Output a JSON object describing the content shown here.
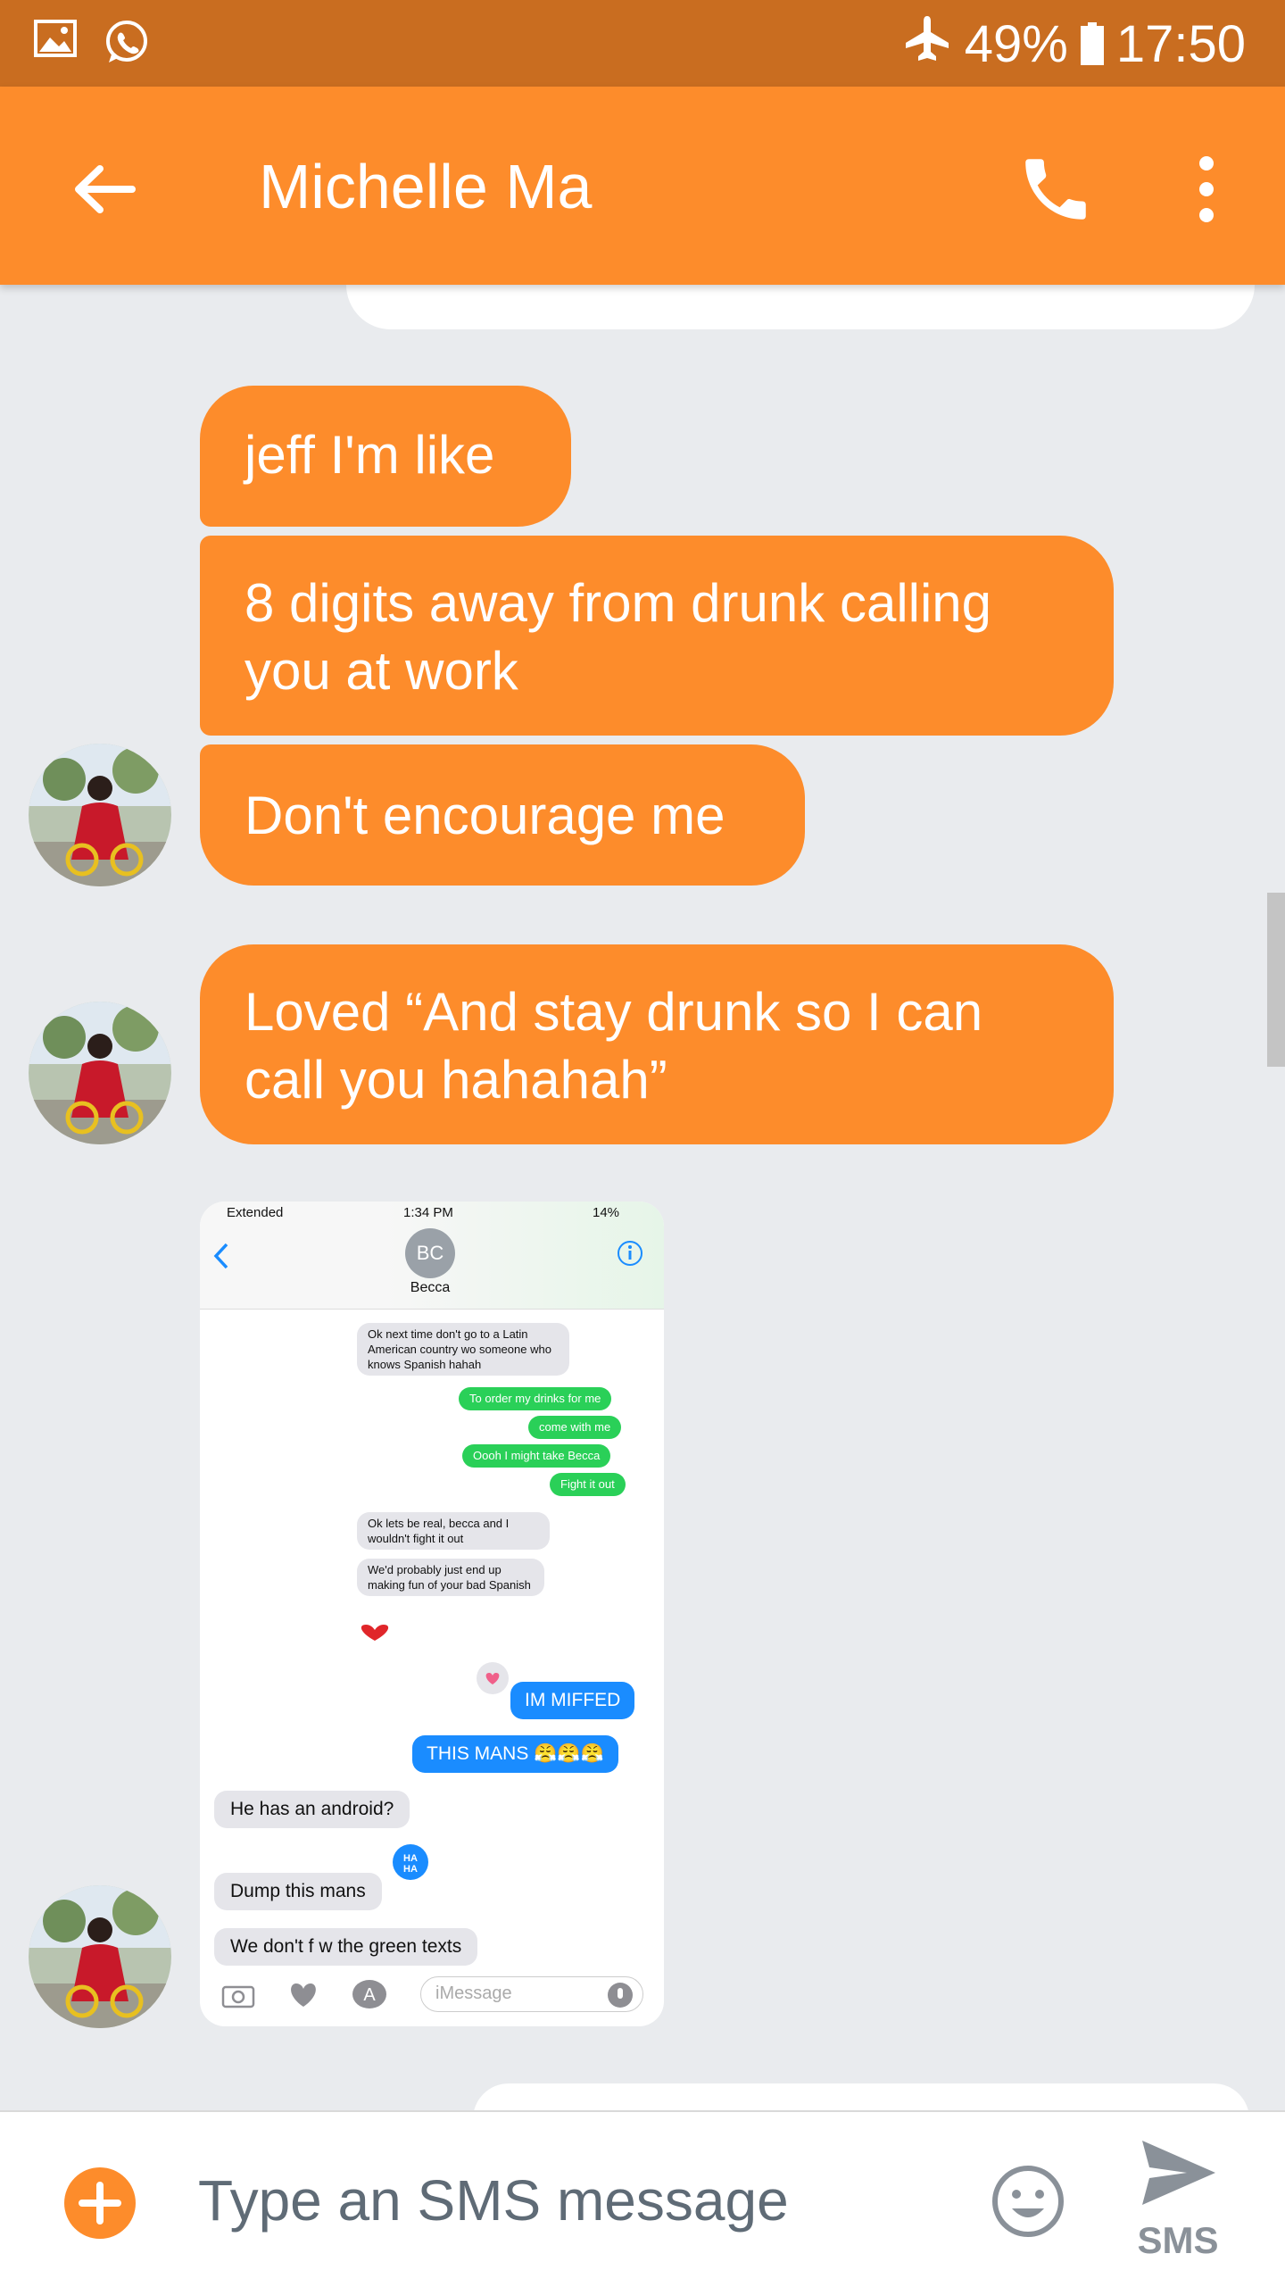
{
  "status_bar": {
    "battery": "49%",
    "time": "17:50",
    "icons": [
      "gallery-icon",
      "whatsapp-icon",
      "airplane-mode-icon",
      "battery-icon"
    ]
  },
  "app_bar": {
    "contact_name": "Michelle Ma",
    "icons": [
      "back-arrow-icon",
      "phone-icon",
      "more-vert-icon"
    ]
  },
  "messages": [
    {
      "text": "jeff I'm like"
    },
    {
      "text": "8 digits away from drunk calling you at work"
    },
    {
      "text": "Don't encourage me"
    },
    {
      "text": "Loved “And stay drunk so I can call you hahahah”"
    }
  ],
  "embedded_screenshot": {
    "carrier": "Extended",
    "time": "1:34 PM",
    "battery": "14%",
    "contact_initials": "BC",
    "contact_name": "Becca",
    "messages": [
      {
        "side": "in",
        "text": "Ok next time don't go to a Latin American country wo someone who knows Spanish hahah"
      },
      {
        "side": "out-green",
        "text": "To order my drinks for me"
      },
      {
        "side": "out-green",
        "text": "come with me"
      },
      {
        "side": "out-green",
        "text": "Oooh I might take Becca"
      },
      {
        "side": "out-green",
        "text": "Fight it out"
      },
      {
        "side": "in",
        "text": "Ok lets be real, becca and I wouldn't fight it out"
      },
      {
        "side": "in",
        "text": "We'd probably just end up making fun of your bad Spanish"
      },
      {
        "side": "out-blue",
        "text": "IM MIFFED"
      },
      {
        "side": "out-blue",
        "text": "THIS MANS 😤😤😤"
      },
      {
        "side": "in",
        "text": "He has an android?"
      },
      {
        "side": "in",
        "text": "Dump this mans"
      },
      {
        "side": "in",
        "text": "We don't f w the green texts"
      }
    ],
    "input_placeholder": "iMessage"
  },
  "composer": {
    "placeholder": "Type an SMS message",
    "send_label": "SMS"
  },
  "colors": {
    "accent": "#fd8c2b",
    "status_bar": "#c96d20",
    "background": "#e9ebee"
  }
}
